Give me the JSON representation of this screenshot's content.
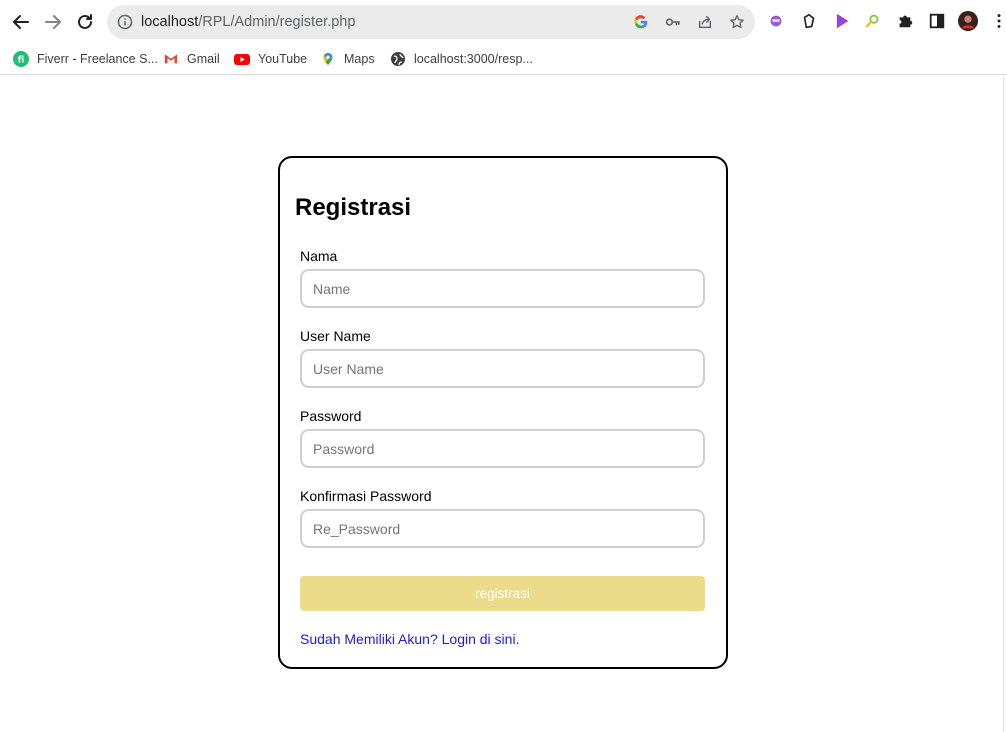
{
  "browser": {
    "url_host": "localhost",
    "url_path": "/RPL/Admin/register.php",
    "bookmarks": [
      {
        "label": "Fiverr - Freelance S...",
        "icon": "fiverr-icon"
      },
      {
        "label": "Gmail",
        "icon": "gmail-icon"
      },
      {
        "label": "YouTube",
        "icon": "youtube-icon"
      },
      {
        "label": "Maps",
        "icon": "maps-icon"
      },
      {
        "label": "localhost:3000/resp...",
        "icon": "globe-icon"
      }
    ]
  },
  "form": {
    "title": "Registrasi",
    "fields": [
      {
        "label": "Nama",
        "placeholder": "Name"
      },
      {
        "label": "User Name",
        "placeholder": "User Name"
      },
      {
        "label": "Password",
        "placeholder": "Password"
      },
      {
        "label": "Konfirmasi Password",
        "placeholder": "Re_Password"
      }
    ],
    "submit_label": "registrasi",
    "login_link": "Sudah Memiliki Akun? Login di sini."
  },
  "colors": {
    "button": "#ebdc8b",
    "link": "#1a1aee",
    "card_border": "#000000"
  }
}
